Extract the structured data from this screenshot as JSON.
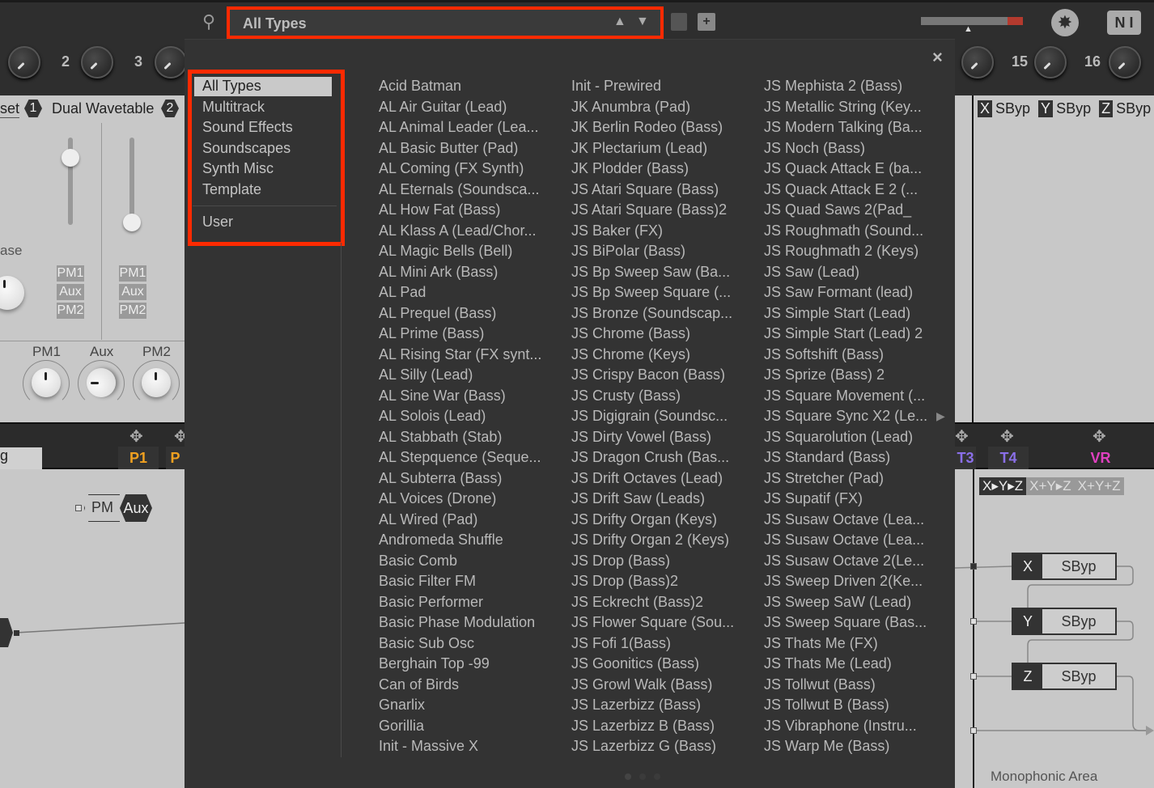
{
  "search": {
    "value": "All Types",
    "up_icon": "triangle-up-icon",
    "down_icon": "triangle-down-icon"
  },
  "macro_knobs": {
    "left": [
      "2",
      "3"
    ],
    "right": [
      "15",
      "16"
    ]
  },
  "left_panel": {
    "preset_label": "set",
    "badge1": "1",
    "oscillator_name": "Dual Wavetable",
    "badge2": "2",
    "phase_label": "ase",
    "tags": [
      "PM1",
      "Aux",
      "PM2"
    ],
    "knob_labels": [
      "PM1",
      "Aux",
      "PM2"
    ],
    "tab_text": "g",
    "slot_labels": [
      "P1",
      "P"
    ],
    "pm_label": "PM",
    "aux_label": "Aux"
  },
  "right_panel": {
    "header": [
      {
        "key": "X",
        "value": "SByp"
      },
      {
        "key": "Y",
        "value": "SByp"
      },
      {
        "key": "Z",
        "value": "SByp"
      }
    ],
    "slot_labels": [
      "T3",
      "T4",
      "VR"
    ],
    "routing_modes": [
      "X▸Y▸Z",
      "X+Y▸Z",
      "X+Y+Z"
    ],
    "fx": [
      {
        "key": "X",
        "value": "SByp"
      },
      {
        "key": "Y",
        "value": "SByp"
      },
      {
        "key": "Z",
        "value": "SByp"
      }
    ],
    "area_label": "Monophonic Area"
  },
  "colors": {
    "highlight": "#ff2a00",
    "purple": "#8a6fe8",
    "magenta": "#e040c0",
    "orange": "#f0a020"
  },
  "browser": {
    "close": "×",
    "categories": [
      "All Types",
      "Multitrack",
      "Sound Effects",
      "Soundscapes",
      "Synth Misc",
      "Template"
    ],
    "user": "User",
    "selected_category": "All Types",
    "columns": [
      [
        "Acid Batman",
        "AL Air Guitar (Lead)",
        "AL Animal Leader (Lea...",
        "AL Basic Butter (Pad)",
        "AL Coming (FX Synth)",
        "AL Eternals (Soundsca...",
        "AL How Fat (Bass)",
        "AL Klass A (Lead/Chor...",
        "AL Magic Bells (Bell)",
        "AL Mini Ark (Bass)",
        "AL Pad",
        "AL Prequel (Bass)",
        "AL Prime (Bass)",
        "AL Rising Star (FX synt...",
        "AL Silly (Lead)",
        "AL Sine War (Bass)",
        "AL Solois (Lead)",
        "AL Stabbath (Stab)",
        "AL Stepquence (Seque...",
        "AL Subterra (Bass)",
        "AL Voices (Drone)",
        "AL Wired (Pad)",
        "Andromeda Shuffle",
        "Basic Comb",
        "Basic Filter FM",
        "Basic Performer",
        "Basic Phase Modulation",
        "Basic Sub Osc",
        "Berghain Top -99",
        "Can of Birds",
        "Gnarlix",
        "Gorillia",
        "Init - Massive X"
      ],
      [
        "Init - Prewired",
        "JK Anumbra (Pad)",
        "JK Berlin Rodeo (Bass)",
        "JK Plectarium (Lead)",
        "JK Plodder (Bass)",
        "JS Atari Square (Bass)",
        "JS Atari Square (Bass)2",
        "JS Baker (FX)",
        "JS BiPolar (Bass)",
        "JS Bp Sweep Saw (Ba...",
        "JS Bp Sweep Square (...",
        "JS Bronze (Soundscap...",
        "JS Chrome (Bass)",
        "JS Chrome (Keys)",
        "JS Crispy Bacon (Bass)",
        "JS Crusty (Bass)",
        "JS Digigrain (Soundsc...",
        "JS Dirty Vowel (Bass)",
        "JS Dragon Crush (Bas...",
        "JS Drift Octaves (Lead)",
        "JS Drift Saw (Leads)",
        "JS Drifty Organ (Keys)",
        "JS Drifty Organ 2 (Keys)",
        "JS Drop (Bass)",
        "JS Drop (Bass)2",
        "JS Eckrecht (Bass)2",
        "JS Flower Square (Sou...",
        "JS Fofi 1(Bass)",
        "JS Goonitics (Bass)",
        "JS Growl Walk (Bass)",
        "JS Lazerbizz (Bass)",
        "JS Lazerbizz B (Bass)",
        "JS Lazerbizz G (Bass)"
      ],
      [
        "JS Mephista 2 (Bass)",
        "JS Metallic String (Key...",
        "JS Modern Talking (Ba...",
        "JS Noch (Bass)",
        "JS Quack Attack E (ba...",
        "JS Quack Attack E 2 (...",
        "JS Quad Saws 2(Pad_",
        "JS Roughmath (Sound...",
        "JS Roughmath 2 (Keys)",
        "JS Saw (Lead)",
        "JS Saw Formant (lead)",
        "JS Simple Start (Lead)",
        "JS Simple Start (Lead) 2",
        "JS Softshift (Bass)",
        "JS Sprize (Bass) 2",
        "JS Square Movement (...",
        "JS Square Sync X2 (Le...",
        "JS Squarolution (Lead)",
        "JS Standard (Bass)",
        "JS Stretcher (Pad)",
        "JS Supatif (FX)",
        "JS Susaw Octave (Lea...",
        "JS Susaw Octave (Lea...",
        "JS Susaw Octave 2(Le...",
        "JS Sweep Driven 2(Ke...",
        "JS Sweep SaW (Lead)",
        "JS Sweep Square (Bas...",
        "JS Thats Me (FX)",
        "JS Thats Me (Lead)",
        "JS Tollwut (Bass)",
        "JS Tollwut B (Bass)",
        "JS Vibraphone (Instru...",
        "JS Warp Me (Bass)"
      ]
    ]
  }
}
